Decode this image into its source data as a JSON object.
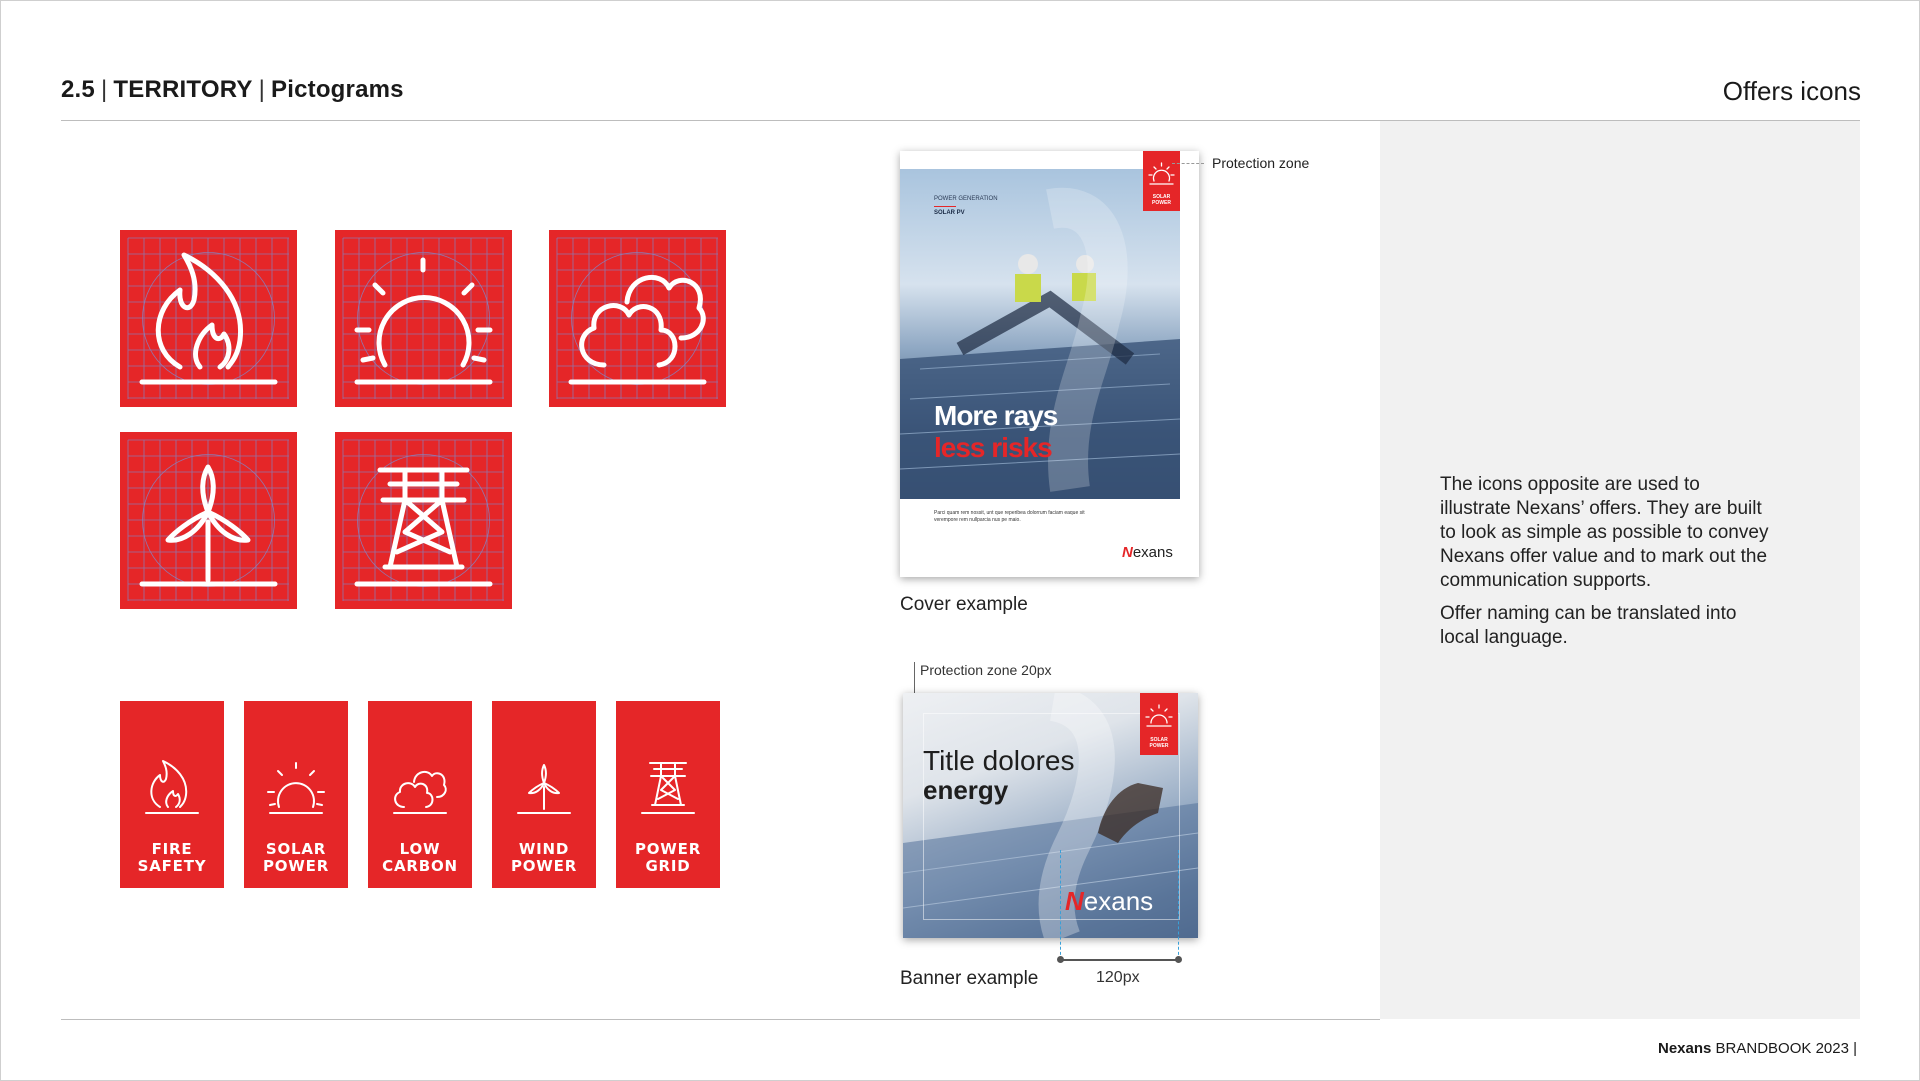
{
  "header": {
    "section": "2.5",
    "chapter": "TERRITORY",
    "topic": "Pictograms",
    "right_title": "Offers icons"
  },
  "grid_icons": [
    {
      "name": "flame-icon"
    },
    {
      "name": "sun-icon"
    },
    {
      "name": "cloud-icon"
    },
    {
      "name": "wind-turbine-icon"
    },
    {
      "name": "pylon-icon"
    }
  ],
  "tiles": [
    {
      "line1": "FIRE",
      "line2": "SAFETY",
      "icon": "flame-icon"
    },
    {
      "line1": "SOLAR",
      "line2": "POWER",
      "icon": "sun-icon"
    },
    {
      "line1": "LOW",
      "line2": "CARBON",
      "icon": "cloud-icon"
    },
    {
      "line1": "WIND",
      "line2": "POWER",
      "icon": "wind-turbine-icon"
    },
    {
      "line1": "POWER",
      "line2": "GRID",
      "icon": "pylon-icon"
    }
  ],
  "cover": {
    "protection_label": "Protection zone",
    "category": "POWER GENERATION",
    "subcategory": "SOLAR PV",
    "badge_line1": "SOLAR",
    "badge_line2": "POWER",
    "headline1": "More rays",
    "headline2": "less risks",
    "body": "Parci quam rem nossit, unt que reperibea dolorrum faciam eaque sit verempore rem nullparcia nus pe maio.",
    "logo_initial": "N",
    "logo_rest": "exans",
    "caption": "Cover example"
  },
  "banner": {
    "protection_label": "Protection zone 20px",
    "title_line1": "Title dolores",
    "title_line2": "energy",
    "badge_line1": "SOLAR",
    "badge_line2": "POWER",
    "logo_initial": "N",
    "logo_rest": "exans",
    "dimension_label": "120px",
    "caption": "Banner example"
  },
  "description": {
    "p1": "The icons opposite are used to illustrate Nexans’ offers. They are built to look as simple as possible to convey Nexans offer value and to mark out the communication supports.",
    "p2": "Offer naming can be translated into local language."
  },
  "footer": {
    "brand": "Nexans",
    "text": "BRANDBOOK 2023 |"
  },
  "colors": {
    "brand_red": "#e52628",
    "panel_gray": "#f1f1f1"
  }
}
